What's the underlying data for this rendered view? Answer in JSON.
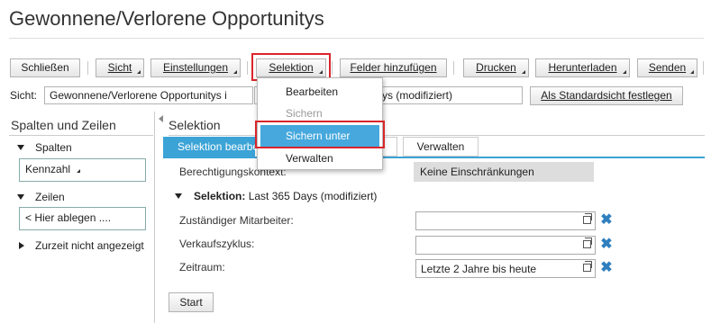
{
  "title": "Gewonnene/Verlorene Opportunitys",
  "toolbar": {
    "close": "Schließen",
    "view": "Sicht",
    "settings": "Einstellungen",
    "selection": "Selektion",
    "add_fields": "Felder hinzufügen",
    "print": "Drucken",
    "download": "Herunterladen",
    "send": "Senden"
  },
  "viewbar": {
    "label": "Sicht:",
    "selected_view": "Gewonnene/Verlorene Opportunitys i",
    "selection_value": "ys (modifiziert)",
    "set_default": "Als Standardsicht festlegen"
  },
  "left_panel": {
    "title": "Spalten und Zeilen",
    "columns_label": "Spalten",
    "columns_field": "Kennzahl",
    "rows_label": "Zeilen",
    "rows_field": "< Hier ablegen ....",
    "hidden_label": "Zurzeit nicht angezeigt"
  },
  "right_panel": {
    "title": "Selektion",
    "tabs": [
      "Selektion bearbeiten",
      "Verwalten"
    ],
    "auth_label": "Berechtigungskontext:",
    "auth_value": "Keine Einschränkungen",
    "selection_label": "Selektion:",
    "selection_value": "Last 365 Days (modifiziert)",
    "fields": [
      {
        "label": "Zuständiger Mitarbeiter:",
        "value": ""
      },
      {
        "label": "Verkaufszyklus:",
        "value": ""
      },
      {
        "label": "Zeitraum:",
        "value": "Letzte 2 Jahre bis heute"
      }
    ],
    "start": "Start"
  },
  "menu": {
    "items": [
      "Bearbeiten",
      "Sichern",
      "Sichern unter",
      "Verwalten"
    ],
    "disabled_item": "Sichern",
    "highlighted_item": "Sichern unter"
  },
  "colors": {
    "accent": "#3ba3d6",
    "highlight_border": "#d9262b",
    "clear_icon": "#2f7fbf"
  }
}
